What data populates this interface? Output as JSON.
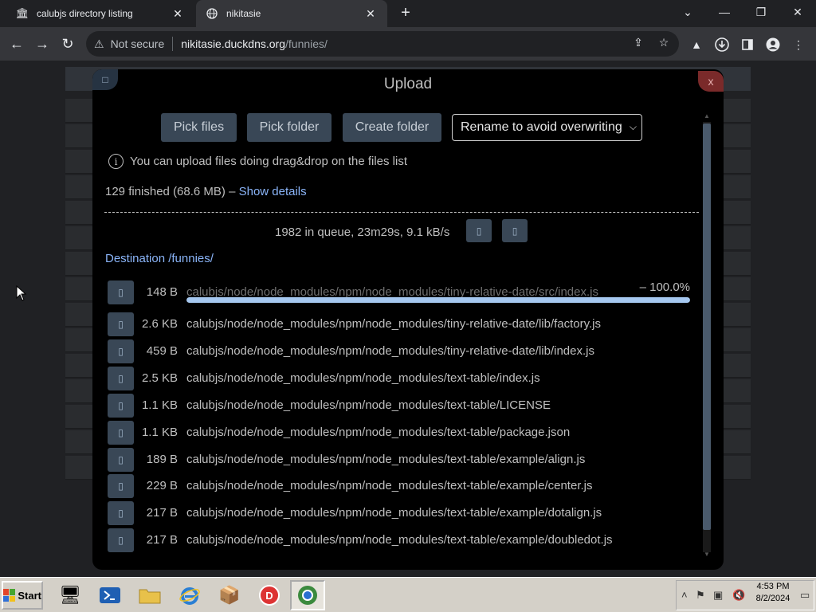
{
  "browser": {
    "tabs": [
      {
        "title": "calubjs directory listing",
        "active": false
      },
      {
        "title": "nikitasie",
        "active": true
      }
    ],
    "address": {
      "security": "Not secure",
      "host": "nikitasie.duckdns.org",
      "path": "/funnies/"
    }
  },
  "upload": {
    "title": "Upload",
    "close_label": "x",
    "buttons": {
      "pick_files": "Pick files",
      "pick_folder": "Pick folder",
      "create_folder": "Create folder"
    },
    "conflict_mode": "Rename to avoid overwriting",
    "info_text": "You can upload files doing drag&drop on the files list",
    "summary": "129 finished (68.6 MB) – ",
    "show_details": "Show details",
    "queue_status": "1982 in queue, 23m29s, 9.1 kB/s",
    "destination": "Destination /funnies/",
    "files": [
      {
        "size": "148 B",
        "path": "calubjs/node/node_modules/npm/node_modules/tiny-relative-date/src/index.js",
        "percent": "– 100.0%",
        "progress": 1.0
      },
      {
        "size": "2.6 KB",
        "path": "calubjs/node/node_modules/npm/node_modules/tiny-relative-date/lib/factory.js"
      },
      {
        "size": "459 B",
        "path": "calubjs/node/node_modules/npm/node_modules/tiny-relative-date/lib/index.js"
      },
      {
        "size": "2.5 KB",
        "path": "calubjs/node/node_modules/npm/node_modules/text-table/index.js"
      },
      {
        "size": "1.1 KB",
        "path": "calubjs/node/node_modules/npm/node_modules/text-table/LICENSE"
      },
      {
        "size": "1.1 KB",
        "path": "calubjs/node/node_modules/npm/node_modules/text-table/package.json"
      },
      {
        "size": "189 B",
        "path": "calubjs/node/node_modules/npm/node_modules/text-table/example/align.js"
      },
      {
        "size": "229 B",
        "path": "calubjs/node/node_modules/npm/node_modules/text-table/example/center.js"
      },
      {
        "size": "217 B",
        "path": "calubjs/node/node_modules/npm/node_modules/text-table/example/dotalign.js"
      },
      {
        "size": "217 B",
        "path": "calubjs/node/node_modules/npm/node_modules/text-table/example/doubledot.js"
      }
    ]
  },
  "taskbar": {
    "start_label": "Start",
    "clock_time": "4:53 PM",
    "clock_date": "8/2/2024"
  },
  "colors": {
    "accent_link": "#8ab4f8",
    "button_bg": "#394756",
    "progress_fill": "#a6c8f0"
  }
}
